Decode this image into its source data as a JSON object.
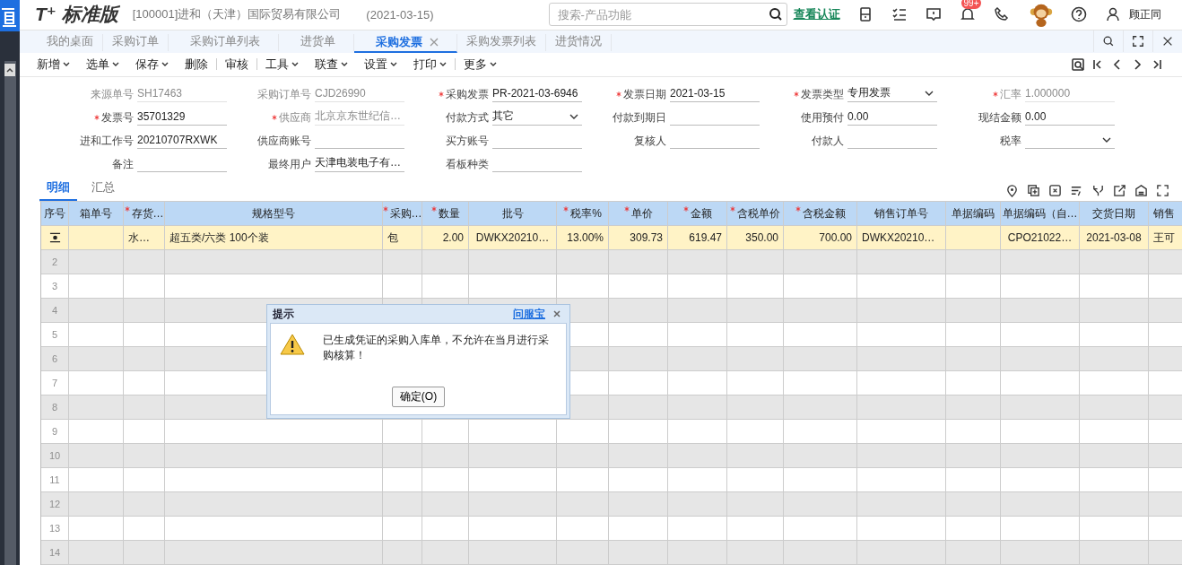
{
  "header": {
    "product": "T⁺ 标准版",
    "company": "[100001]进和（天津）国际贸易有限公司",
    "date": "(2021-03-15)",
    "search": {
      "placeholder": "搜索-产品功能"
    },
    "link": "查看认证",
    "badge": "99+",
    "user": "顾正同"
  },
  "tabs": [
    {
      "label": "我的桌面",
      "selected": false
    },
    {
      "label": "采购订单",
      "selected": false
    },
    {
      "label": "采购订单列表",
      "selected": false
    },
    {
      "label": "进货单",
      "selected": false
    },
    {
      "label": "采购发票",
      "selected": true
    },
    {
      "label": "采购发票列表",
      "selected": false
    },
    {
      "label": "进货情况",
      "selected": false
    }
  ],
  "toolbar": [
    {
      "label": "新增",
      "menu": true
    },
    {
      "label": "选单",
      "menu": true
    },
    {
      "label": "保存",
      "menu": true
    },
    {
      "label": "删除",
      "menu": false
    },
    {
      "label": "审核",
      "menu": false
    },
    {
      "label": "工具",
      "menu": true
    },
    {
      "label": "联查",
      "menu": true
    },
    {
      "label": "设置",
      "menu": true
    },
    {
      "label": "打印",
      "menu": true
    },
    {
      "label": "更多",
      "menu": true
    }
  ],
  "form": [
    {
      "label": "来源单号",
      "value": "SH17463",
      "required": false,
      "disabled": true
    },
    {
      "label": "采购订单号",
      "value": "CJD26990",
      "required": false,
      "disabled": true
    },
    {
      "label": "采购发票",
      "value": "PR-2021-03-6946",
      "required": true,
      "disabled": false
    },
    {
      "label": "发票日期",
      "value": "2021-03-15",
      "required": true,
      "disabled": false
    },
    {
      "label": "发票类型",
      "value": "专用发票",
      "required": true,
      "disabled": false,
      "kind": "select"
    },
    {
      "label": "汇率",
      "value": "1.000000",
      "required": true,
      "disabled": true
    },
    {
      "label": "发票号",
      "value": "35701329",
      "required": true,
      "disabled": false
    },
    {
      "label": "供应商",
      "value": "北京京东世纪信…",
      "required": true,
      "disabled": true
    },
    {
      "label": "付款方式",
      "value": "其它",
      "required": false,
      "disabled": false,
      "kind": "select"
    },
    {
      "label": "付款到期日",
      "required": false,
      "disabled": false
    },
    {
      "label": "使用预付",
      "value": "0.00",
      "required": false,
      "disabled": false
    },
    {
      "label": "现结金额",
      "value": "0.00",
      "required": false,
      "disabled": false
    },
    {
      "label": "进和工作号",
      "value": "20210707RXWK",
      "required": false,
      "disabled": false
    },
    {
      "label": "供应商账号",
      "required": false,
      "disabled": false
    },
    {
      "label": "买方账号",
      "required": false,
      "disabled": false
    },
    {
      "label": "复核人",
      "required": false,
      "disabled": false
    },
    {
      "label": "付款人",
      "required": false,
      "disabled": false
    },
    {
      "label": "税率",
      "required": false,
      "disabled": false,
      "kind": "select"
    },
    {
      "label": "备注",
      "required": false,
      "disabled": false
    },
    {
      "label": "最终用户",
      "value": "天津电装电子有…",
      "required": false,
      "disabled": false
    },
    {
      "label": "看板种类",
      "required": false,
      "disabled": false
    }
  ],
  "detail_tabs": [
    {
      "label": "明细",
      "selected": true
    },
    {
      "label": "汇总",
      "selected": false
    }
  ],
  "table": {
    "columns": [
      {
        "label": "序号",
        "required": false
      },
      {
        "label": "箱单号",
        "required": false
      },
      {
        "label": "存货…",
        "required": true
      },
      {
        "label": "规格型号",
        "required": false
      },
      {
        "label": "采购…",
        "required": true
      },
      {
        "label": "数量",
        "required": true
      },
      {
        "label": "批号",
        "required": false
      },
      {
        "label": "税率%",
        "required": true
      },
      {
        "label": "单价",
        "required": true
      },
      {
        "label": "金额",
        "required": true
      },
      {
        "label": "含税单价",
        "required": true
      },
      {
        "label": "含税金额",
        "required": true
      },
      {
        "label": "销售订单号",
        "required": false
      },
      {
        "label": "单据编码",
        "required": false
      },
      {
        "label": "单据编码（自…",
        "required": false
      },
      {
        "label": "交货日期",
        "required": false
      },
      {
        "label": "销售",
        "required": false
      }
    ],
    "rows": [
      {
        "current": true,
        "cells": [
          null,
          null,
          "水…",
          "超五类/六类 100个装",
          "包",
          "2.00",
          "DWKX20210…",
          "13.00%",
          "309.73",
          "619.47",
          "350.00",
          "700.00",
          "DWKX20210…",
          null,
          "CPO21022…",
          "2021-03-08",
          "王可"
        ]
      },
      {
        "current": false,
        "number": "2"
      },
      {
        "current": false,
        "number": "3"
      },
      {
        "current": false,
        "number": "4"
      },
      {
        "current": false,
        "number": "5"
      },
      {
        "current": false,
        "number": "6"
      },
      {
        "current": false,
        "number": "7"
      },
      {
        "current": false,
        "number": "8"
      },
      {
        "current": false,
        "number": "9"
      },
      {
        "current": false,
        "number": "10"
      },
      {
        "current": false,
        "number": "11"
      },
      {
        "current": false,
        "number": "12"
      },
      {
        "current": false,
        "number": "13"
      },
      {
        "current": false,
        "number": "14"
      }
    ]
  },
  "dialog": {
    "title": "提示",
    "link": "问服宝",
    "message": "已生成凭证的采购入库单，不允许在当月进行采购核算！",
    "button": "确定(O)"
  }
}
